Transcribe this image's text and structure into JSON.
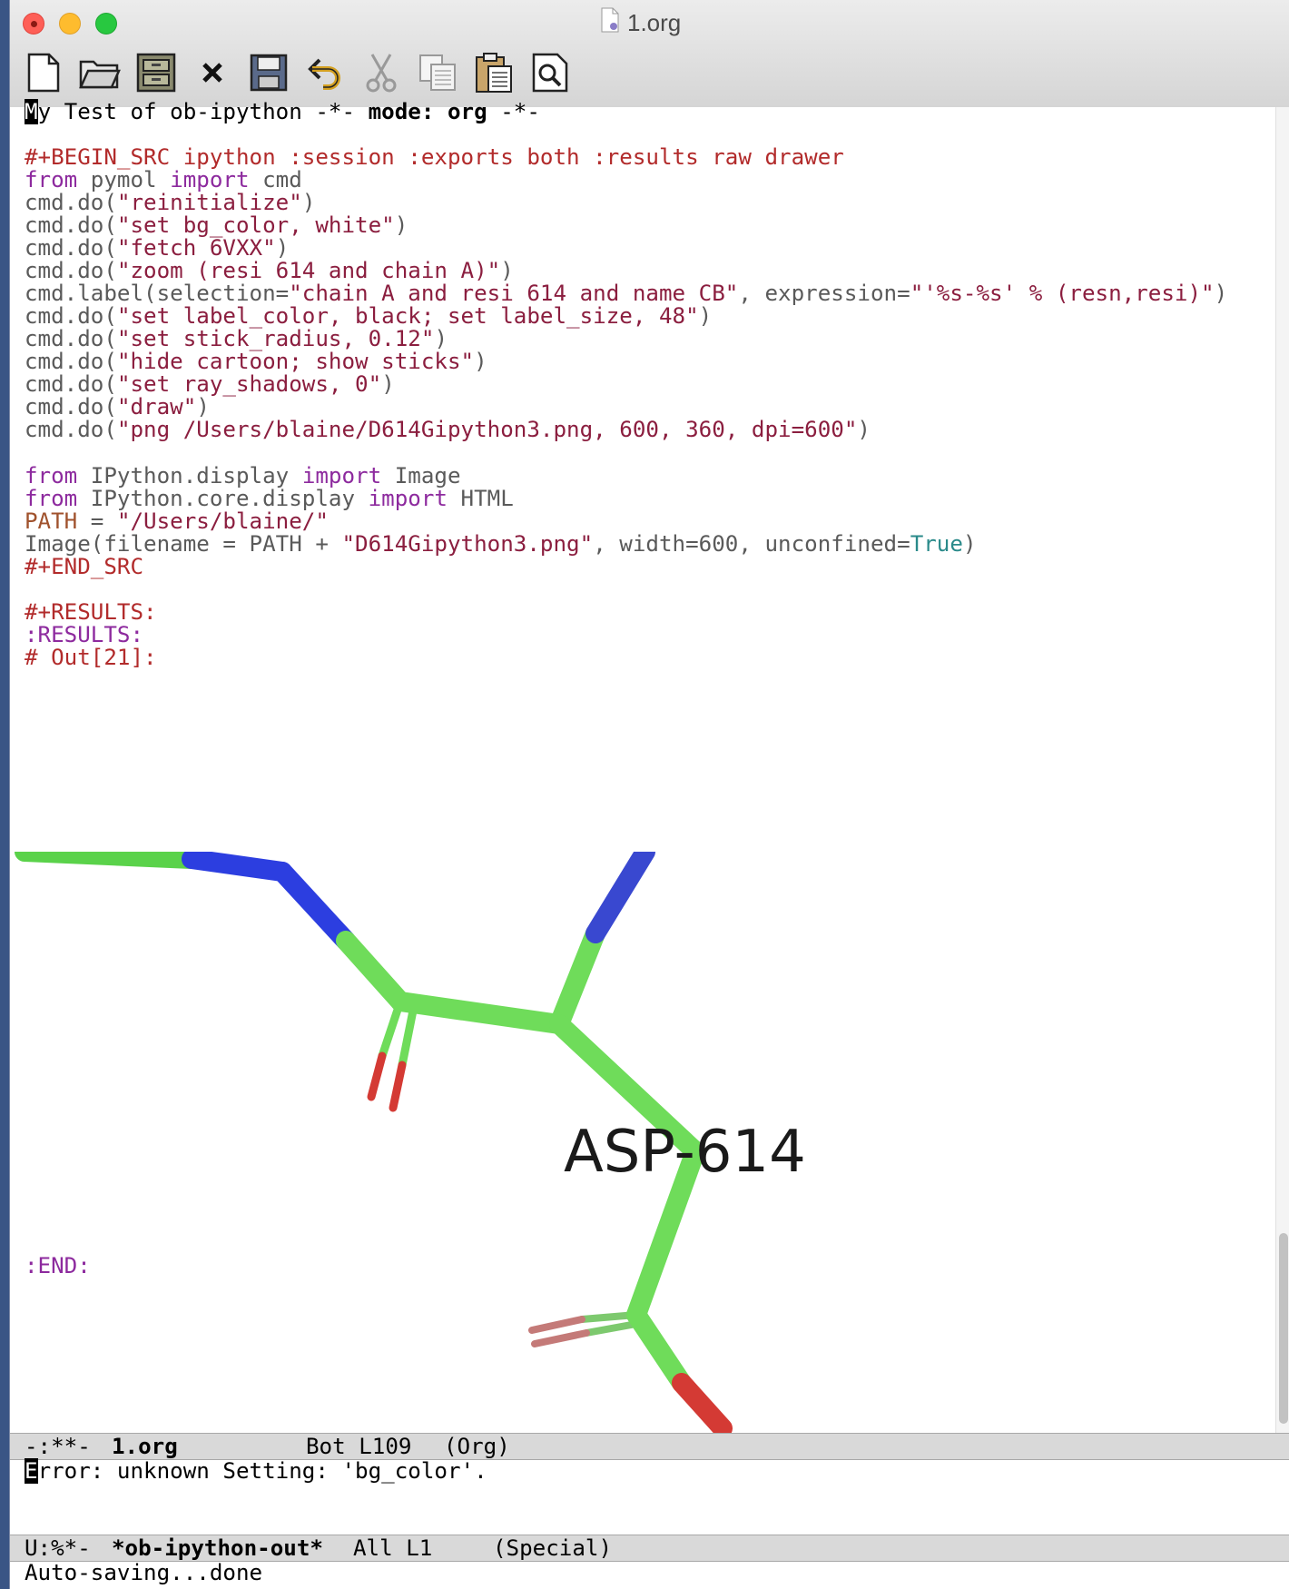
{
  "window": {
    "title": "1.org"
  },
  "toolbar": {
    "buttons": [
      "new-file",
      "open-file",
      "dired",
      "close-buffer",
      "save",
      "undo",
      "cut",
      "copy",
      "paste",
      "search"
    ]
  },
  "editor": {
    "header": {
      "cursor_char": "M",
      "text": "y Test of ob-ipython ",
      "sep1": "-*-",
      "mode": " mode: org ",
      "sep2": "-*-"
    },
    "begin_src": "#+BEGIN_SRC ipython :session :exports both :results raw drawer",
    "code": {
      "l1": {
        "a": "from",
        "b": " pymol ",
        "c": "import",
        "d": " cmd"
      },
      "l2": {
        "a": "cmd.do(",
        "b": "\"reinitialize\"",
        "c": ")"
      },
      "l3": {
        "a": "cmd.do(",
        "b": "\"set bg_color, white\"",
        "c": ")"
      },
      "l4": {
        "a": "cmd.do(",
        "b": "\"fetch 6VXX\"",
        "c": ")"
      },
      "l5": {
        "a": "cmd.do(",
        "b": "\"zoom (resi 614 and chain A)\"",
        "c": ")"
      },
      "l6": {
        "a": "cmd.label(selection=",
        "b": "\"chain A and resi 614 and name CB\"",
        "c": ", expression=",
        "d": "\"'%s-%s' % (resn,resi)\"",
        "e": ")"
      },
      "l7": {
        "a": "cmd.do(",
        "b": "\"set label_color, black; set label_size, 48\"",
        "c": ")"
      },
      "l8": {
        "a": "cmd.do(",
        "b": "\"set stick_radius, 0.12\"",
        "c": ")"
      },
      "l9": {
        "a": "cmd.do(",
        "b": "\"hide cartoon; show sticks\"",
        "c": ")"
      },
      "l10": {
        "a": "cmd.do(",
        "b": "\"set ray_shadows, 0\"",
        "c": ")"
      },
      "l11": {
        "a": "cmd.do(",
        "b": "\"draw\"",
        "c": ")"
      },
      "l12": {
        "a": "cmd.do(",
        "b": "\"png /Users/blaine/D614Gipython3.png, 600, 360, dpi=600\"",
        "c": ")"
      },
      "l13": {
        "a": "from",
        "b": " IPython.display ",
        "c": "import",
        "d": " Image"
      },
      "l14": {
        "a": "from",
        "b": " IPython.core.display ",
        "c": "import",
        "d": " HTML"
      },
      "l15": {
        "a": "PATH",
        "b": " = ",
        "c": "\"/Users/blaine/\""
      },
      "l16": {
        "a": "Image(filename = PATH + ",
        "b": "\"D614Gipython3.png\"",
        "c": ", width=600, unconfined=",
        "d": "True",
        "e": ")"
      }
    },
    "end_src": "#+END_SRC",
    "results": "#+RESULTS:",
    "results_drawer": ":RESULTS:",
    "out": "# Out[21]:",
    "image_label": "ASP-614",
    "end": ":END:"
  },
  "modeline1": {
    "status": "-:**-",
    "buffer": "1.org",
    "position": "Bot L109",
    "mode": "(Org)"
  },
  "echo1": {
    "cursor_char": "E",
    "text": "rror: unknown Setting: 'bg_color'."
  },
  "modeline2": {
    "status": "U:%*-",
    "buffer": "*ob-ipython-out*",
    "position": "All L1",
    "mode": "(Special)"
  },
  "minibuffer": "Auto-saving...done",
  "colors": {
    "carbon": "#6fdc5a",
    "nitrogen": "#3346d8",
    "oxygen": "#d43a34"
  }
}
